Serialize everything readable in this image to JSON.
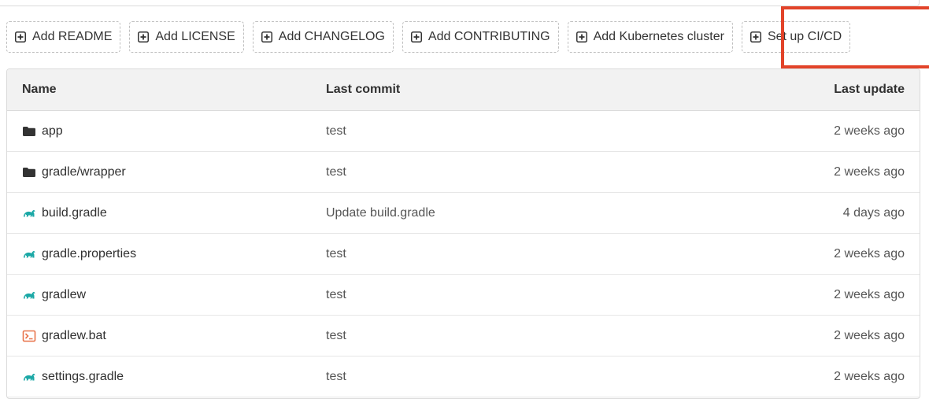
{
  "actions": [
    {
      "label": "Add README"
    },
    {
      "label": "Add LICENSE"
    },
    {
      "label": "Add CHANGELOG"
    },
    {
      "label": "Add CONTRIBUTING"
    },
    {
      "label": "Add Kubernetes cluster"
    },
    {
      "label": "Set up CI/CD"
    }
  ],
  "table": {
    "headers": {
      "name": "Name",
      "commit": "Last commit",
      "update": "Last update"
    },
    "rows": [
      {
        "icon": "folder-icon",
        "name": "app",
        "commit": "test",
        "update": "2 weeks ago"
      },
      {
        "icon": "folder-icon",
        "name": "gradle/wrapper",
        "commit": "test",
        "update": "2 weeks ago"
      },
      {
        "icon": "gradle-icon",
        "name": "build.gradle",
        "commit": "Update build.gradle",
        "update": "4 days ago"
      },
      {
        "icon": "gradle-icon",
        "name": "gradle.properties",
        "commit": "test",
        "update": "2 weeks ago"
      },
      {
        "icon": "gradle-icon",
        "name": "gradlew",
        "commit": "test",
        "update": "2 weeks ago"
      },
      {
        "icon": "terminal-icon",
        "name": "gradlew.bat",
        "commit": "test",
        "update": "2 weeks ago"
      },
      {
        "icon": "gradle-icon",
        "name": "settings.gradle",
        "commit": "test",
        "update": "2 weeks ago"
      }
    ]
  },
  "colors": {
    "highlight": "#e24329",
    "gradle": "#1ba8a6",
    "terminal": "#e8734a",
    "folder": "#333333"
  }
}
